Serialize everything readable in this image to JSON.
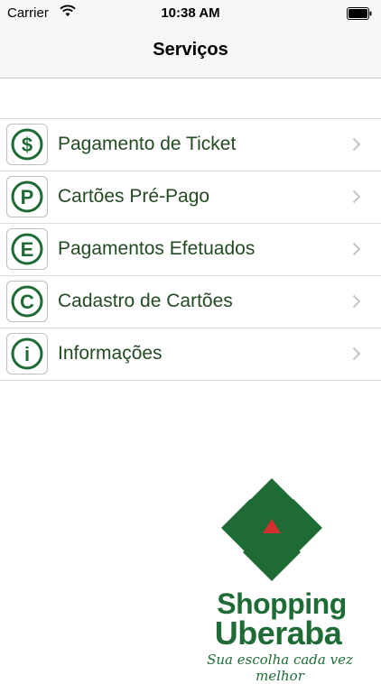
{
  "status_bar": {
    "carrier": "Carrier",
    "time": "10:38 AM"
  },
  "header": {
    "title": "Serviços"
  },
  "services": [
    {
      "label": "Pagamento de Ticket",
      "icon_letter": "$",
      "icon": "dollar-icon"
    },
    {
      "label": "Cartões Pré-Pago",
      "icon_letter": "P",
      "icon": "p-letter-icon"
    },
    {
      "label": "Pagamentos Efetuados",
      "icon_letter": "E",
      "icon": "e-letter-icon"
    },
    {
      "label": "Cadastro de Cartões",
      "icon_letter": "C",
      "icon": "c-letter-icon"
    },
    {
      "label": "Informações",
      "icon_letter": "i",
      "icon": "info-icon"
    }
  ],
  "brand": {
    "name_line1": "Shopping",
    "name_line2": "Uberaba",
    "tagline": "Sua escolha cada vez melhor"
  },
  "colors": {
    "accent_green": "#1e6b35",
    "logo_red": "#d32f2f"
  }
}
